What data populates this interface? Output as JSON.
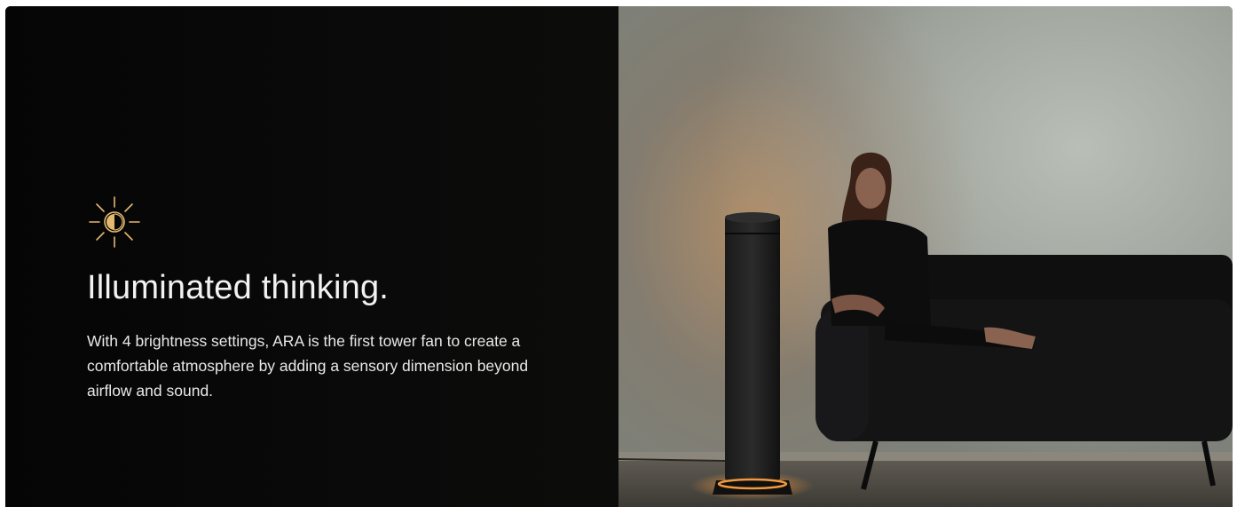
{
  "feature": {
    "icon": "brightness-half-sun-icon",
    "title": "Illuminated thinking.",
    "description": "With 4 brightness settings, ARA is the first tower fan to create a comfortable atmosphere by adding a sensory dimension beyond airflow and sound."
  },
  "colors": {
    "background": "#060606",
    "icon_accent": "#e2b96f",
    "text": "#f2f2f2",
    "fan_glow": "#f29a3c"
  }
}
